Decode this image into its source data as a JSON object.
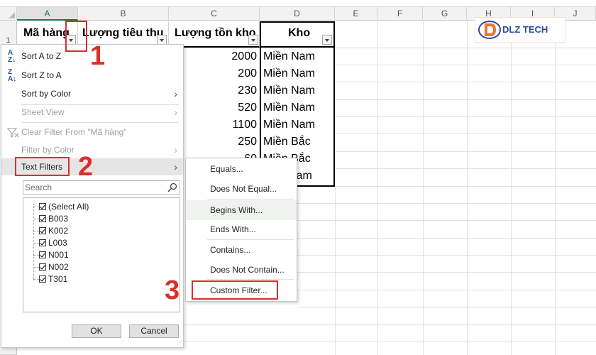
{
  "columns": [
    "A",
    "B",
    "C",
    "D",
    "E",
    "F",
    "G",
    "H",
    "I",
    "J"
  ],
  "row_numbers": [
    "1"
  ],
  "table": {
    "headers": [
      "Mã hàng",
      "Lượng tiêu thụ",
      "Lượng tồn kho",
      "Kho"
    ],
    "rows": [
      {
        "ton": "2000",
        "kho": "Miền Nam"
      },
      {
        "ton": "200",
        "kho": "Miền Nam"
      },
      {
        "ton": "230",
        "kho": "Miền Nam"
      },
      {
        "ton": "520",
        "kho": "Miền Nam"
      },
      {
        "ton": "1100",
        "kho": "Miền Nam"
      },
      {
        "ton": "250",
        "kho": "Miền Bắc"
      },
      {
        "ton": "60",
        "kho": "Miền Bắc"
      },
      {
        "ton": "",
        "kho": "Nam"
      }
    ]
  },
  "dropdown": {
    "sort_az": "Sort A to Z",
    "sort_za": "Sort Z to A",
    "sort_by_color": "Sort by Color",
    "sheet_view": "Sheet View",
    "clear_filter": "Clear Filter From \"Mã hàng\"",
    "filter_by_color": "Filter by Color",
    "text_filters": "Text Filters",
    "search_placeholder": "Search",
    "items": [
      "(Select All)",
      "B003",
      "K002",
      "L003",
      "N001",
      "N002",
      "T301"
    ],
    "ok": "OK",
    "cancel": "Cancel"
  },
  "submenu": {
    "items": [
      "Equals...",
      "Does Not Equal...",
      "Begins With...",
      "Ends With...",
      "Contains...",
      "Does Not Contain...",
      "Custom Filter..."
    ]
  },
  "annotations": {
    "step1": "1",
    "step2": "2",
    "step3": "3"
  },
  "logo": {
    "text": "DLZ TECH",
    "letter": "D"
  },
  "colors": {
    "accent_red": "#d9302c",
    "excel_green": "#217346",
    "logo_orange": "#e8772e",
    "logo_blue": "#2d4a9c"
  }
}
